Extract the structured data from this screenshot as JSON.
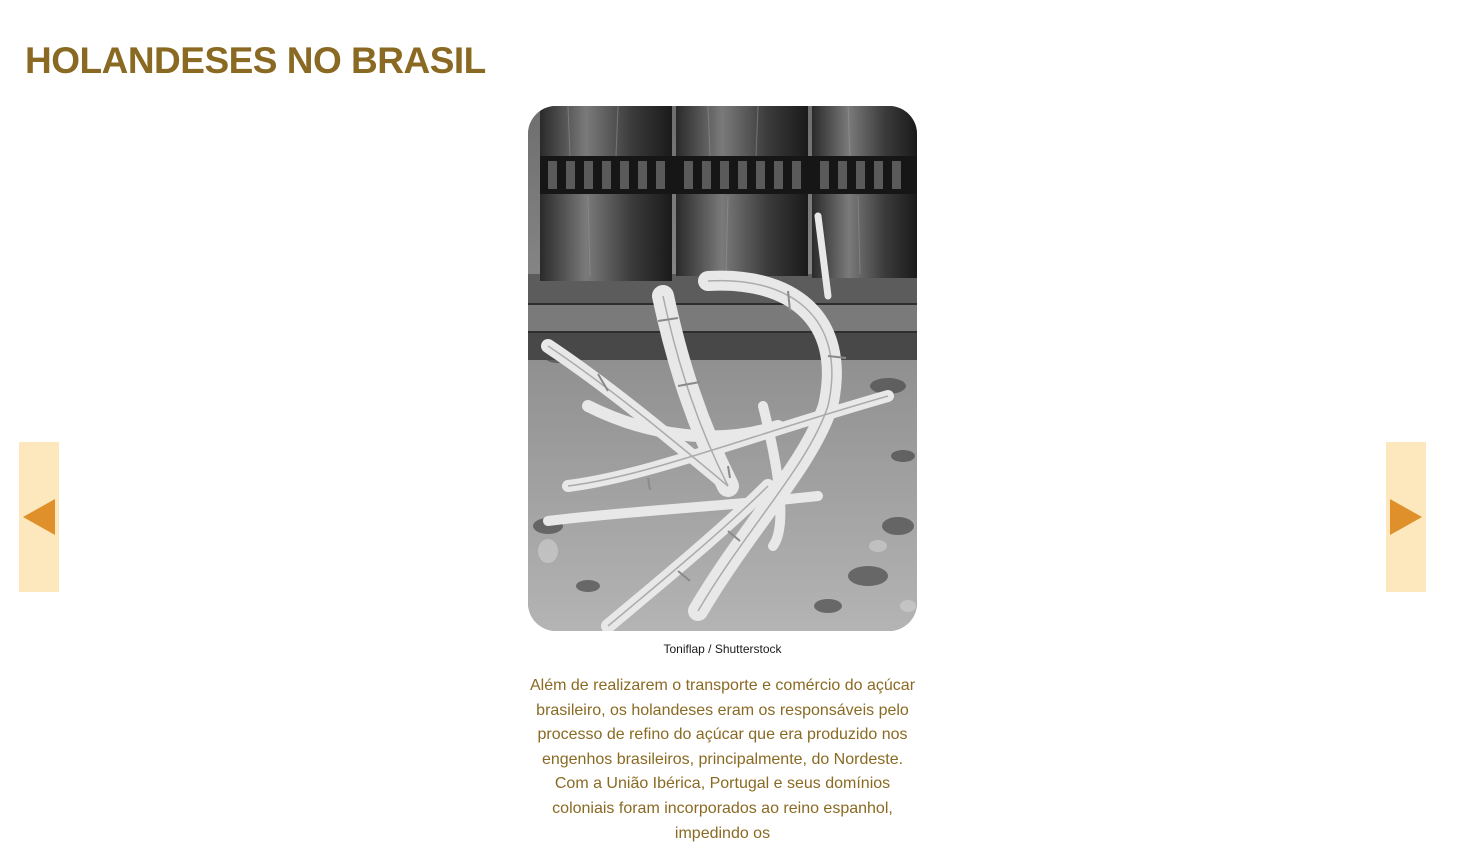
{
  "header": {
    "title": "HOLANDESES NO BRASIL"
  },
  "figure": {
    "image_icon": "sugarcane-mill-photo",
    "credit": "Toniflap / Shutterstock"
  },
  "content": {
    "paragraph": "Além de realizarem o transporte e comércio do açúcar brasileiro, os holandeses eram os responsáveis pelo processo de refino do açúcar que era produzido nos engenhos brasileiros, principalmente, do Nordeste. Com a União Ibérica, Portugal e seus domínios coloniais foram incorporados ao reino espanhol, impedindo os"
  },
  "navigation": {
    "prev_icon": "triangle-left-icon",
    "next_icon": "triangle-right-icon"
  },
  "colors": {
    "title": "#8a6a23",
    "body_text": "#8a6a23",
    "nav_background": "#fde8bd",
    "nav_arrow": "#e0902a"
  }
}
